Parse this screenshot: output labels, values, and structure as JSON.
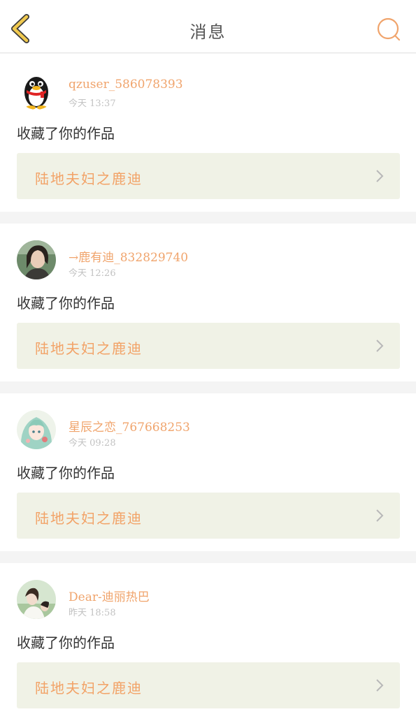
{
  "header": {
    "title": "消息",
    "back_icon": "chevron-left-icon",
    "search_icon": "search-icon",
    "accent_color": "#f0a46c",
    "back_color": "#e8c04a"
  },
  "messages": [
    {
      "username": "qzuser_586078393",
      "time": "今天 13:37",
      "action": "收藏了你的作品",
      "work_title": "陆地夫妇之鹿迪",
      "avatar": "qq-penguin-avatar"
    },
    {
      "username": "→鹿有迪_832829740",
      "time": "今天 12:26",
      "action": "收藏了你的作品",
      "work_title": "陆地夫妇之鹿迪",
      "avatar": "photo-avatar"
    },
    {
      "username": "星辰之恋_767668253",
      "time": "今天 09:28",
      "action": "收藏了你的作品",
      "work_title": "陆地夫妇之鹿迪",
      "avatar": "anime-avatar"
    },
    {
      "username": "Dear-迪丽热巴",
      "time": "昨天 18:58",
      "action": "收藏了你的作品",
      "work_title": "陆地夫妇之鹿迪",
      "avatar": "photo-avatar"
    }
  ]
}
